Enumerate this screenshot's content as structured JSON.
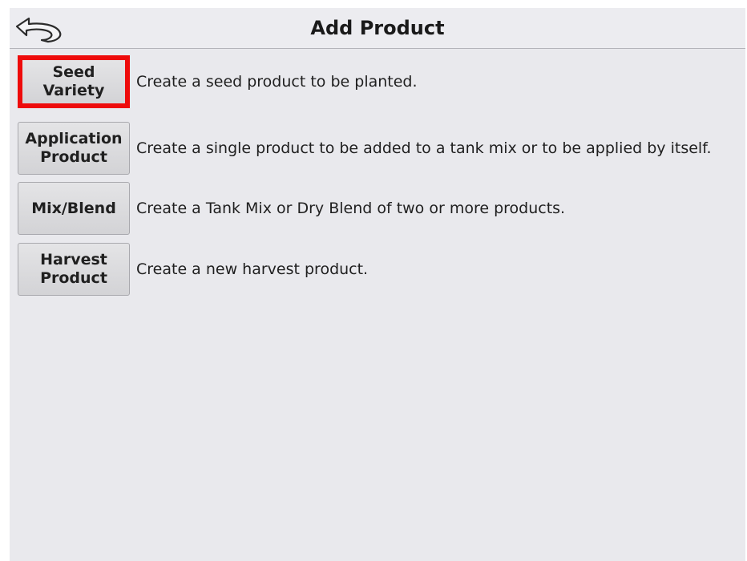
{
  "header": {
    "title": "Add Product",
    "back_icon": "back-arrow-icon"
  },
  "options": [
    {
      "button_label": "Seed\nVariety",
      "description": "Create a seed product to be planted.",
      "selected": true,
      "highlight_color": "#ee0b0b"
    },
    {
      "button_label": "Application\nProduct",
      "description": "Create a single product to be added to a tank mix or to be applied by itself.",
      "selected": false
    },
    {
      "button_label": "Mix/Blend",
      "description": "Create a Tank Mix or Dry Blend of two or more products.",
      "selected": false
    },
    {
      "button_label": "Harvest\nProduct",
      "description": "Create a new harvest product.",
      "selected": false
    }
  ]
}
